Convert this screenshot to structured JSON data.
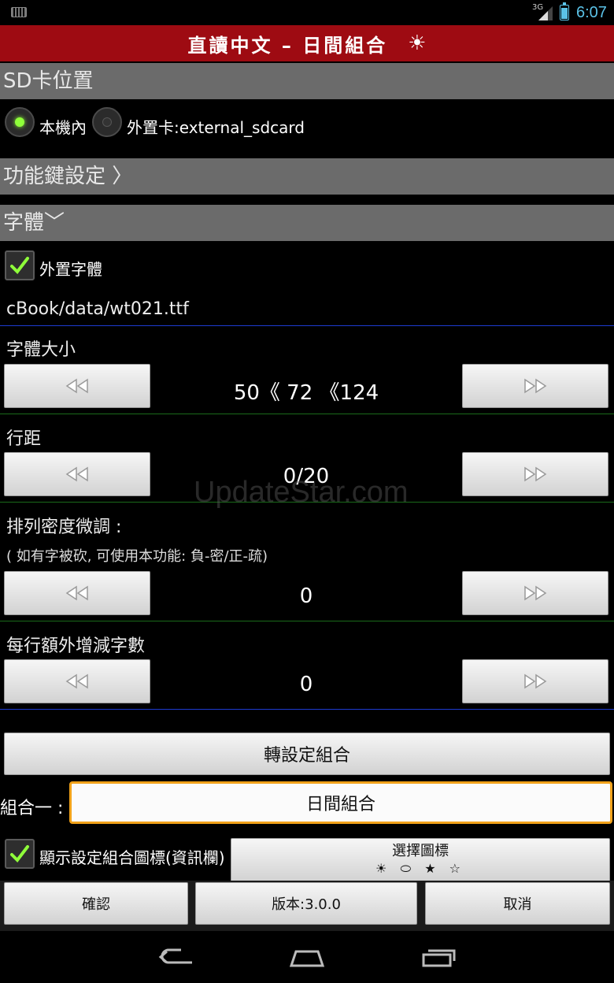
{
  "status_bar": {
    "network": "3G",
    "time": "6:07",
    "icons": [
      "keyboard-icon",
      "signal-icon",
      "battery-icon"
    ]
  },
  "title_bar": {
    "title": "直讀中文 – 日間組合",
    "icon": "sun-icon",
    "glyph": "☀"
  },
  "sd_section": {
    "header": "SD卡位置",
    "options": [
      {
        "label": "本機內",
        "selected": true
      },
      {
        "label": "外置卡:external_sdcard",
        "selected": false
      }
    ]
  },
  "function_keys": {
    "header": "功能鍵設定 〉"
  },
  "font_section": {
    "header": "字體﹀",
    "external_font": {
      "label": "外置字體",
      "checked": true
    },
    "font_path": "cBook/data/wt021.ttf"
  },
  "font_size": {
    "label": "字體大小",
    "value": "50《 72 《124"
  },
  "line_spacing": {
    "label": "行距",
    "value": "0/20"
  },
  "density": {
    "label": "排列密度微調 :",
    "hint": "( 如有字被砍, 可使用本功能: 負-密/正-疏)",
    "value": "0"
  },
  "extra_chars": {
    "label": "每行額外增減字數",
    "value": "0"
  },
  "combo": {
    "switch_button": "轉設定組合",
    "label": "組合一 :",
    "value": "日間組合",
    "show_icon": {
      "label": "顯示設定組合圖標(資訊欄)",
      "checked": true
    },
    "choose_icon": {
      "label": "選擇圖標",
      "glyphs": "☀ ⬭ ★ ☆"
    }
  },
  "bottom_buttons": {
    "confirm": "確認",
    "version": "版本:3.0.0",
    "cancel": "取消"
  },
  "watermark": "UpdateStar.com",
  "colors": {
    "title_bar": "#9e0b12",
    "section_header": "#6b6b6b",
    "accent_green": "#8fff3a",
    "input_border": "#f1a21a",
    "clock": "#5bc2e7",
    "divider_blue": "#1d3bd1"
  }
}
